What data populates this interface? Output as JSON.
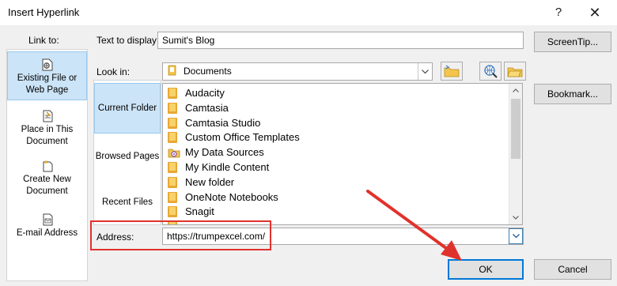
{
  "dialog": {
    "title": "Insert Hyperlink",
    "help_label": "?",
    "close_label": "✕"
  },
  "link_to": {
    "heading": "Link to:",
    "items": [
      {
        "label": "Existing File or Web Page",
        "icon": "globe-file-icon",
        "selected": true
      },
      {
        "label": "Place in This Document",
        "icon": "document-place-icon",
        "selected": false
      },
      {
        "label": "Create New Document",
        "icon": "new-document-icon",
        "selected": false
      },
      {
        "label": "E-mail Address",
        "icon": "email-icon",
        "selected": false
      }
    ]
  },
  "text_to_display": {
    "label": "Text to display:",
    "value": "Sumit's Blog"
  },
  "screentip_button": "ScreenTip...",
  "look_in": {
    "label": "Look in:",
    "value": "Documents"
  },
  "toolbar_icons": [
    "browse-web-folder-icon",
    "browse-web-icon",
    "browse-file-icon"
  ],
  "bookmark_button": "Bookmark...",
  "subnav": {
    "items": [
      {
        "label": "Current Folder",
        "selected": true
      },
      {
        "label": "Browsed Pages",
        "selected": false
      },
      {
        "label": "Recent Files",
        "selected": false
      }
    ]
  },
  "files": [
    {
      "name": "Audacity",
      "icon": "folder-icon"
    },
    {
      "name": "Camtasia",
      "icon": "folder-icon"
    },
    {
      "name": "Camtasia Studio",
      "icon": "folder-icon"
    },
    {
      "name": "Custom Office Templates",
      "icon": "folder-icon"
    },
    {
      "name": "My Data Sources",
      "icon": "data-source-icon"
    },
    {
      "name": "My Kindle Content",
      "icon": "folder-icon"
    },
    {
      "name": "New folder",
      "icon": "folder-icon"
    },
    {
      "name": "OneNote Notebooks",
      "icon": "folder-icon"
    },
    {
      "name": "Snagit",
      "icon": "folder-icon"
    }
  ],
  "address": {
    "label": "Address:",
    "value": "https://trumpexcel.com/"
  },
  "ok_button": "OK",
  "cancel_button": "Cancel",
  "colors": {
    "annotation": "#e0322c",
    "selection": "#cce4f7",
    "accent": "#0078d7"
  }
}
